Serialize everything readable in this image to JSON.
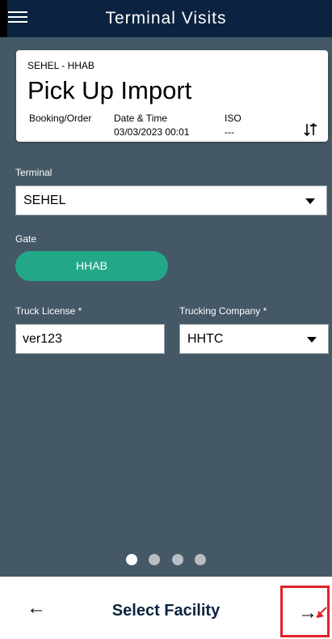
{
  "header": {
    "title": "Terminal Visits",
    "menu_icon": "hamburger-menu-icon"
  },
  "visit_card": {
    "code": "SEHEL - HHAB",
    "type": "Pick Up Import",
    "booking_label": "Booking/Order",
    "booking_value": "",
    "datetime_label": "Date & Time",
    "datetime_value": "03/03/2023 00:01",
    "iso_label": "ISO",
    "iso_value": "---",
    "swap_icon": "swap-vertical-icon"
  },
  "form": {
    "terminal_label": "Terminal",
    "terminal_value": "SEHEL",
    "gate_label": "Gate",
    "gate_value": "HHAB",
    "truck_license_label": "Truck License *",
    "truck_license_value": "ver123",
    "trucking_company_label": "Trucking Company *",
    "trucking_company_value": "HHTC"
  },
  "pager": {
    "total": 4,
    "active_index": 0
  },
  "footer": {
    "back_symbol": "←",
    "title": "Select Facility",
    "next_symbol": "→"
  },
  "colors": {
    "header_bg": "#0b2340",
    "body_bg": "#445866",
    "gate_pill": "#22a889",
    "highlight_box": "#e0222b"
  }
}
